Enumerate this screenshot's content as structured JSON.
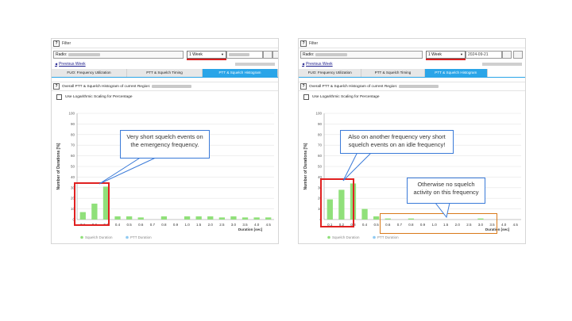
{
  "screenshots": [
    {
      "filter_title": "Filter",
      "radio_label": "Radio:",
      "period": "1 Week",
      "date": "",
      "previous_week": "Previous Week",
      "tabs": [
        "FUO: Frequency Utilization",
        "PTT & Squelch Timing",
        "PTT & Squelch Histogram"
      ],
      "active_tab": 2,
      "section_title": "Overall PTT & Squelch Histogram of current Region:",
      "log_scaling_label": "Use Logarithmic Scaling for Percentage",
      "log_scaling_checked": false,
      "callout": "Very short squelch events on the emergency frequency."
    },
    {
      "filter_title": "Filter",
      "radio_label": "Radio:",
      "period": "1 Week",
      "date": "2024-09-21",
      "previous_week": "Previous Week",
      "tabs": [
        "FUO: Frequency Utilization",
        "PTT & Squelch Timing",
        "PTT & Squelch Histogram"
      ],
      "active_tab": 2,
      "section_title": "Overall PTT & Squelch Histogram of current Region:",
      "log_scaling_label": "Use Logarithmic Scaling for Percentage",
      "log_scaling_checked": false,
      "callout": "Also on another frequency very short squelch events on an idle frequency!",
      "callout2": "Otherwise no squelch activity on this frequency"
    }
  ],
  "colors": {
    "squelch_bar": "#90e07a",
    "ptt_bar": "#8fcaf2",
    "active_tab": "#2aa5e8",
    "highlight_red": "#e02020",
    "highlight_orange": "#d97a1a",
    "callout_border": "#3a7ad8"
  },
  "chart_data": [
    {
      "type": "bar",
      "title": "",
      "xlabel": "Duration [sec]",
      "ylabel": "Number of Durations [%]",
      "ylim": [
        0,
        100
      ],
      "yticks": [
        0,
        10,
        20,
        30,
        40,
        50,
        60,
        70,
        80,
        90,
        100
      ],
      "categories": [
        "0.1",
        "0.2",
        "0.3",
        "0.4",
        "0.5",
        "0.6",
        "0.7",
        "0.8",
        "0.9",
        "1.0",
        "1.5",
        "2.0",
        "2.5",
        "3.0",
        "3.5",
        "4.0",
        "4.5"
      ],
      "series": [
        {
          "name": "Squelch Duration",
          "values": [
            7,
            15,
            31,
            3,
            3,
            2,
            0,
            3,
            0,
            3,
            3,
            3,
            2,
            3,
            2,
            2,
            2
          ]
        },
        {
          "name": "PTT Duration",
          "values": [
            0,
            0,
            0,
            0,
            0,
            0,
            0,
            0,
            0,
            0,
            0,
            0,
            0,
            0,
            0,
            0,
            0
          ]
        }
      ],
      "grid": true,
      "legend": "bottom"
    },
    {
      "type": "bar",
      "title": "",
      "xlabel": "Duration [sec]",
      "ylabel": "Number of Durations [%]",
      "ylim": [
        0,
        100
      ],
      "yticks": [
        0,
        10,
        20,
        30,
        40,
        50,
        60,
        70,
        80,
        90,
        100
      ],
      "categories": [
        "0.1",
        "0.2",
        "0.3",
        "0.4",
        "0.5",
        "0.6",
        "0.7",
        "0.8",
        "0.9",
        "1.0",
        "1.5",
        "2.0",
        "2.5",
        "3.0",
        "3.5",
        "4.0",
        "4.5"
      ],
      "series": [
        {
          "name": "Squelch Duration",
          "values": [
            19,
            28,
            34,
            10,
            3,
            1,
            0,
            1,
            0,
            0,
            0,
            0,
            0,
            1,
            0,
            0,
            0
          ]
        },
        {
          "name": "PTT Duration",
          "values": [
            0,
            0,
            0,
            0,
            0,
            0,
            0,
            0,
            0,
            0,
            0,
            0,
            0,
            0,
            0,
            0,
            0
          ]
        }
      ],
      "grid": true,
      "legend": "bottom"
    }
  ]
}
